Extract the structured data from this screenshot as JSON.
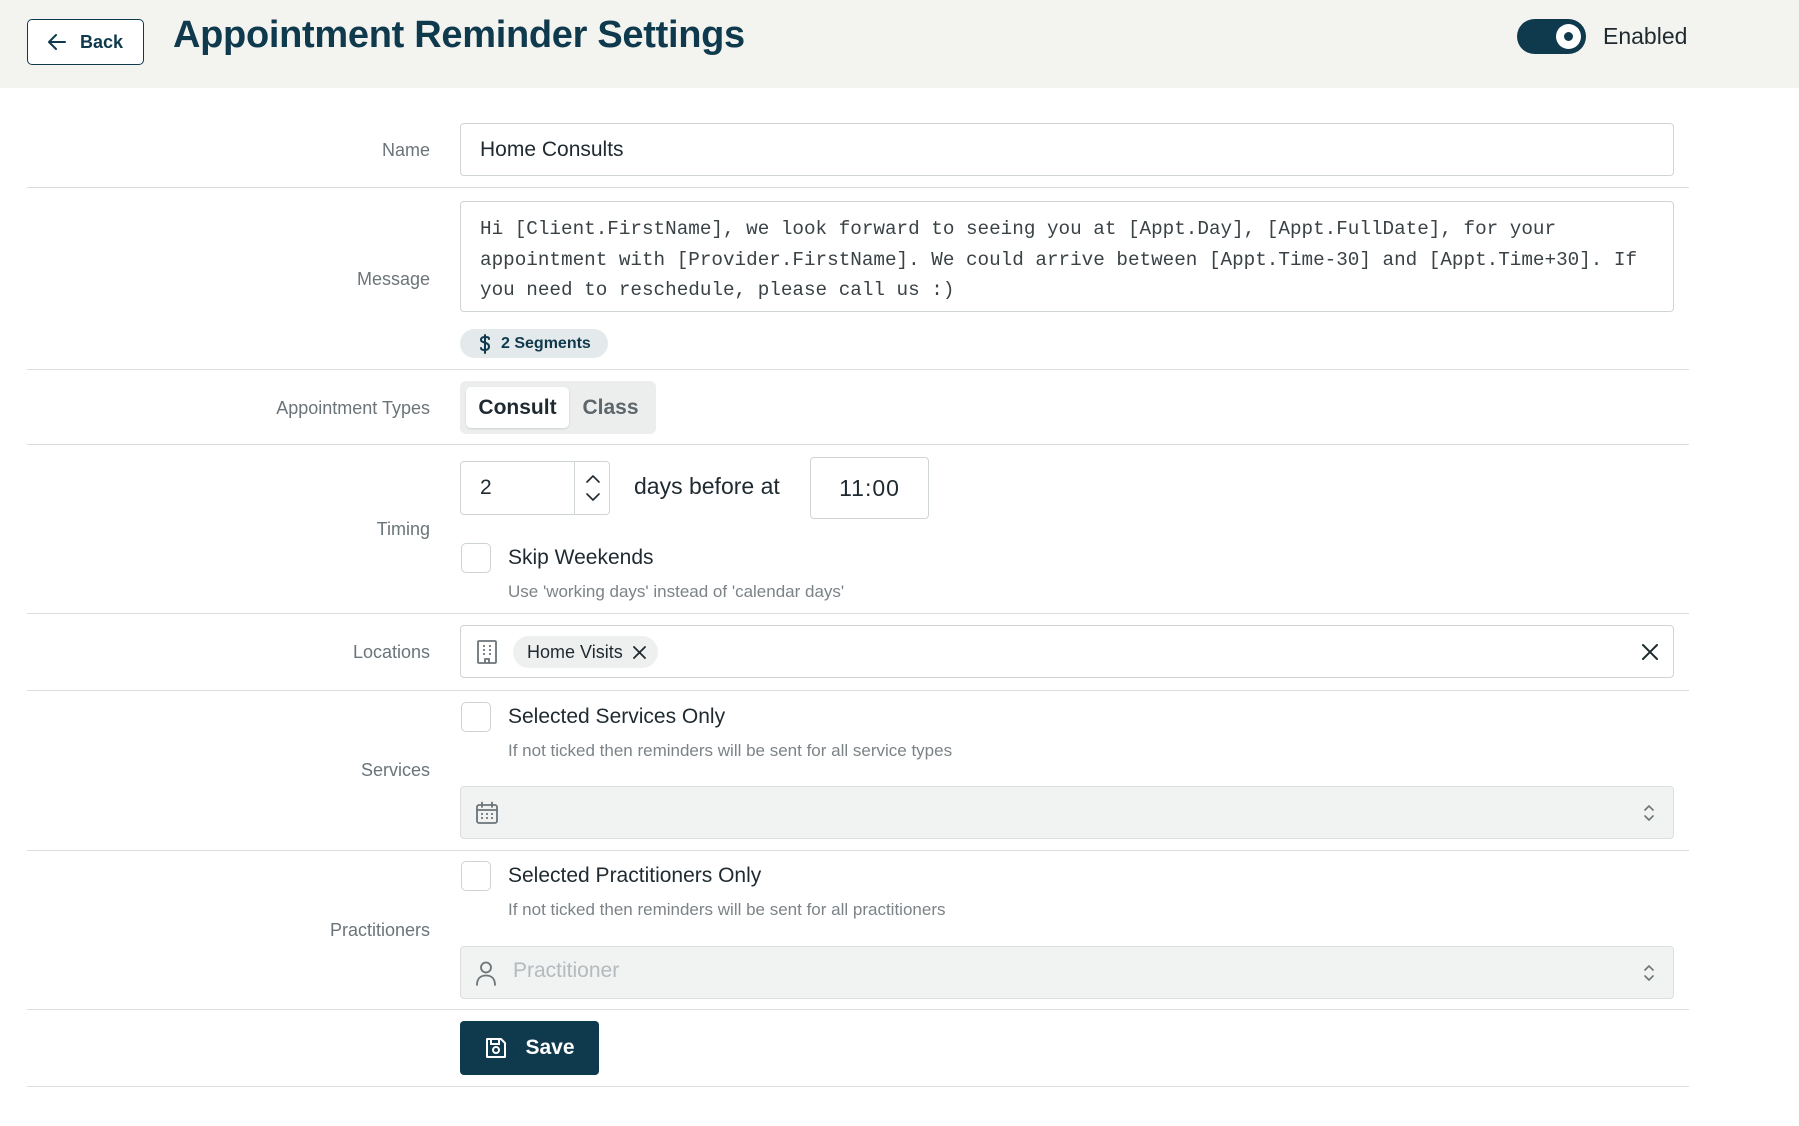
{
  "header": {
    "back_label": "Back",
    "title": "Appointment Reminder Settings",
    "toggle_label": "Enabled",
    "toggle_on": true
  },
  "form": {
    "name": {
      "label": "Name",
      "value": "Home Consults"
    },
    "message": {
      "label": "Message",
      "value": "Hi [Client.FirstName], we look forward to seeing you at [Appt.Day], [Appt.FullDate], for your appointment with [Provider.FirstName]. We could arrive between [Appt.Time-30] and [Appt.Time+30]. If you need to reschedule, please call us :)",
      "segments": "2 Segments"
    },
    "appointment_types": {
      "label": "Appointment Types",
      "options": [
        "Consult",
        "Class"
      ],
      "selected": "Consult"
    },
    "timing": {
      "label": "Timing",
      "days": "2",
      "days_text": "days before at",
      "time": "11:00",
      "skip_weekends_label": "Skip Weekends",
      "skip_weekends_help": "Use 'working days' instead of 'calendar days'",
      "skip_weekends_checked": false
    },
    "locations": {
      "label": "Locations",
      "chips": [
        "Home Visits"
      ]
    },
    "services": {
      "label": "Services",
      "checkbox_label": "Selected Services Only",
      "help": "If not ticked then reminders will be sent for all service types",
      "checked": false
    },
    "practitioners": {
      "label": "Practitioners",
      "checkbox_label": "Selected Practitioners Only",
      "help": "If not ticked then reminders will be sent for all practitioners",
      "placeholder": "Practitioner",
      "checked": false
    },
    "save_label": "Save"
  },
  "colors": {
    "primary": "#0f3a4d",
    "header_bg": "#f3f3ef",
    "label": "#6b7479",
    "border": "#cfd4d6"
  },
  "icons": [
    "arrow-left-icon",
    "dollar-icon",
    "chevron-up-icon",
    "chevron-down-icon",
    "building-icon",
    "close-icon",
    "calendar-icon",
    "user-icon",
    "chevron-updown-icon",
    "save-icon"
  ]
}
